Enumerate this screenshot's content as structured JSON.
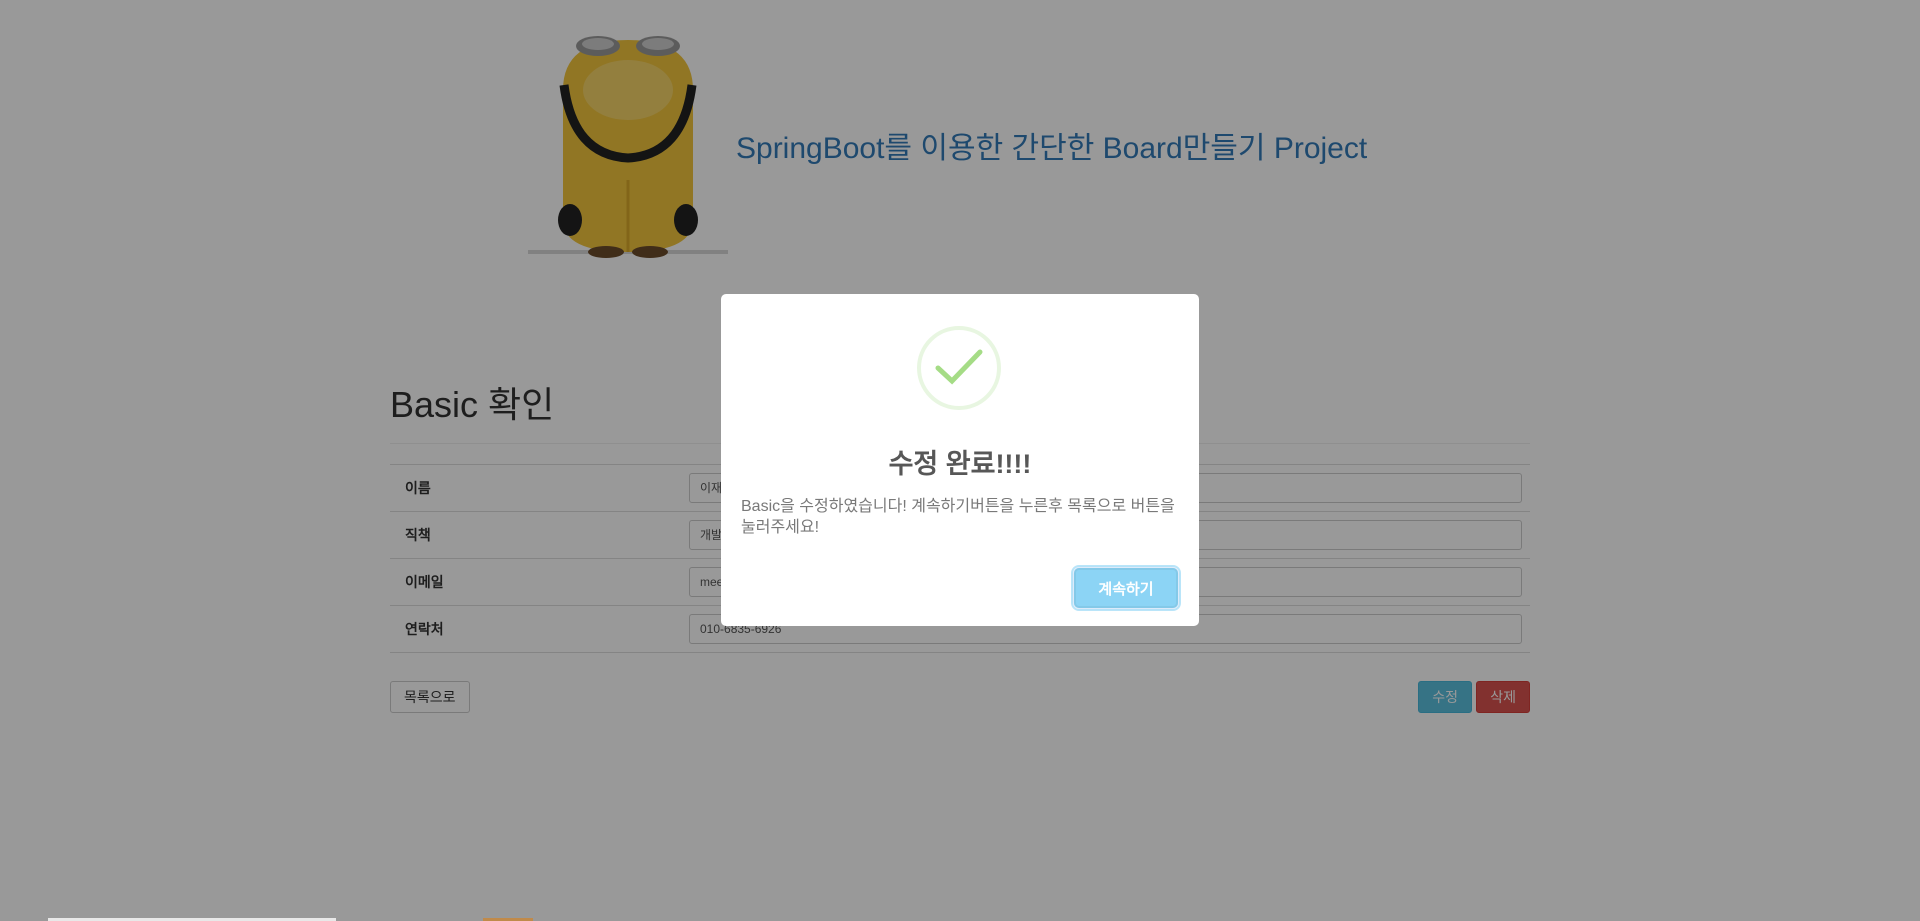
{
  "header": {
    "title": "SpringBoot를 이용한 간단한 Board만들기 Project",
    "logo_icon": "minion-character-icon"
  },
  "main": {
    "heading": "Basic 확인",
    "rows": [
      {
        "label": "이름",
        "value": "이재홍"
      },
      {
        "label": "직책",
        "value": "개발자"
      },
      {
        "label": "이메일",
        "value": "meerkat"
      },
      {
        "label": "연락처",
        "value": "010-6835-6926"
      }
    ],
    "buttons": {
      "list": "목록으로",
      "edit": "수정",
      "delete": "삭제"
    }
  },
  "modal": {
    "icon": "success-check-icon",
    "title": "수정 완료!!!!",
    "text": "Basic을 수정하였습니다! 계속하기버튼을 누른후 목록으로 버튼을 눌러주세요!",
    "confirm_label": "계속하기"
  },
  "colors": {
    "title_blue": "#337ab7",
    "edit_button": "#5bc0de",
    "delete_button": "#d9534f",
    "confirm_button": "#8cd4f5",
    "success_check": "#a5dc86"
  }
}
